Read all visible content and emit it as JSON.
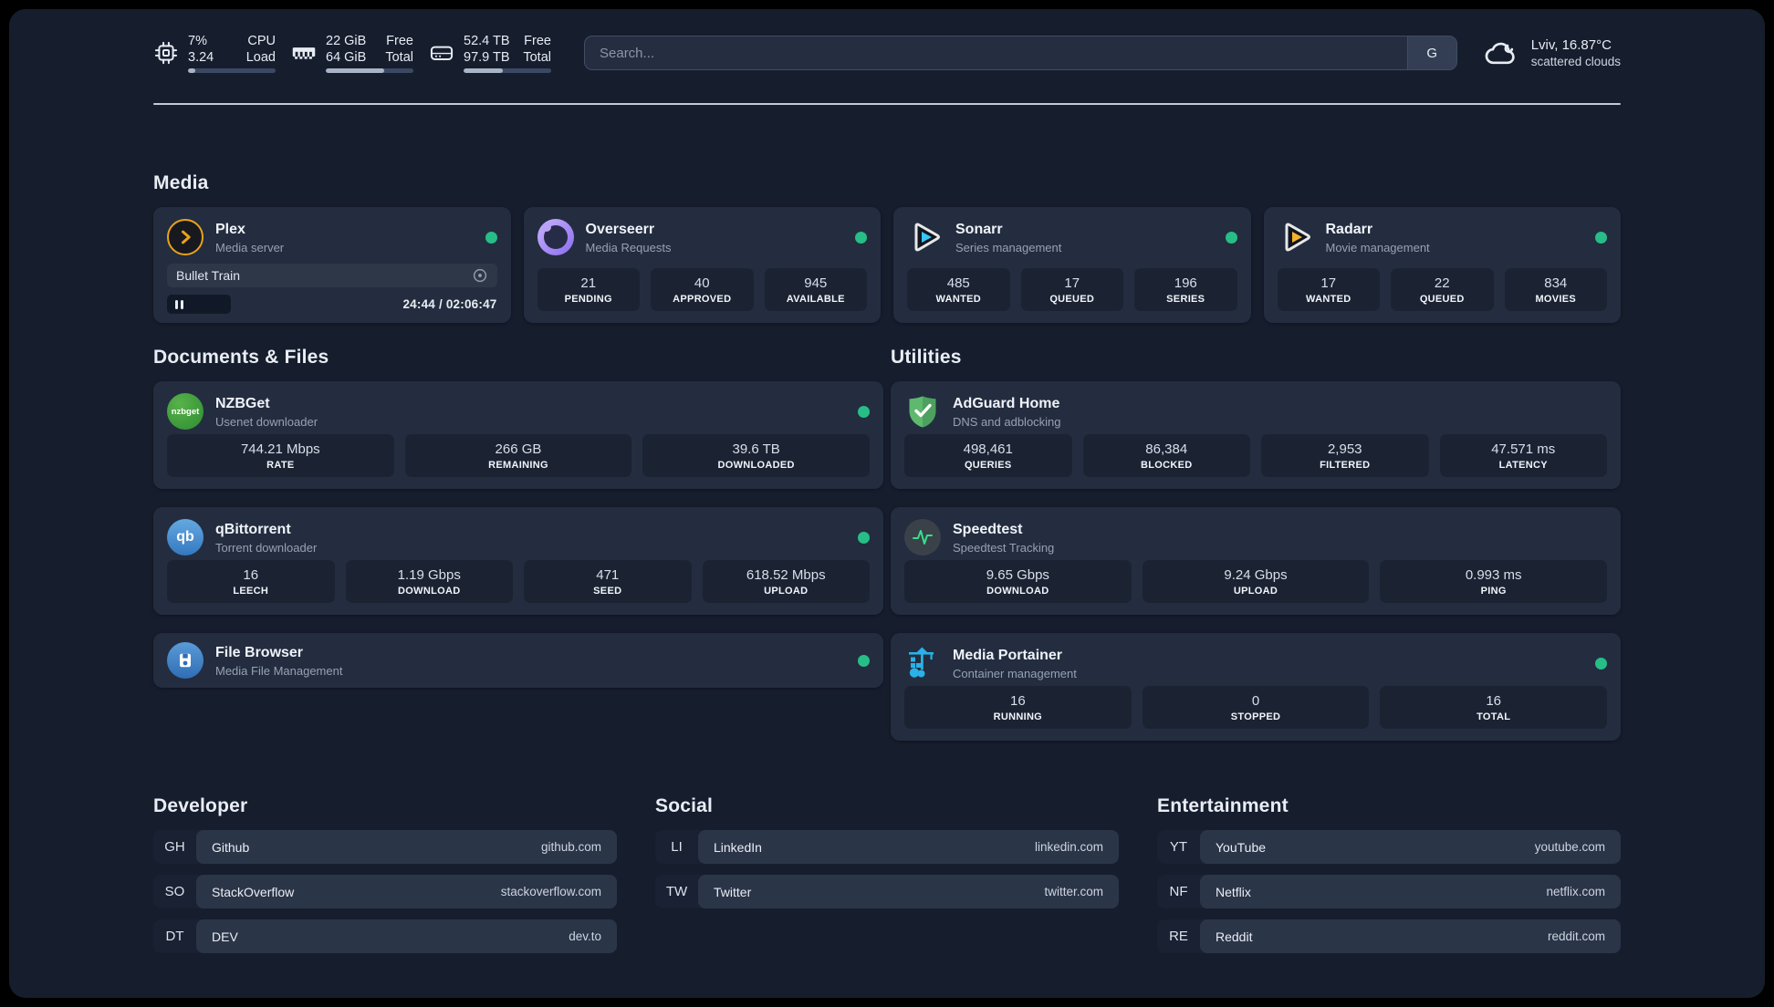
{
  "colors": {
    "page_bg": "#161d2d",
    "card_bg": "#232d3f",
    "stat_bg": "#1b2333",
    "status_online": "#27bd87",
    "plex_accent": "#e9a21b",
    "sonarr_accent": "#38c6f4",
    "radarr_accent": "#f5b12d",
    "portainer_accent": "#29b1e8",
    "adguard_accent": "#5eb86e",
    "speedtest_accent": "#35e08a"
  },
  "topbar": {
    "resources": [
      {
        "icon": "cpu-icon",
        "rows": [
          {
            "value": "7%",
            "label": "CPU"
          },
          {
            "value": "3.24",
            "label": "Load"
          }
        ],
        "progress_pct": 8
      },
      {
        "icon": "memory-icon",
        "rows": [
          {
            "value": "22 GiB",
            "label": "Free"
          },
          {
            "value": "64 GiB",
            "label": "Total"
          }
        ],
        "progress_pct": 67
      },
      {
        "icon": "disk-icon",
        "rows": [
          {
            "value": "52.4 TB",
            "label": "Free"
          },
          {
            "value": "97.9 TB",
            "label": "Total"
          }
        ],
        "progress_pct": 45
      }
    ],
    "search": {
      "placeholder": "Search...",
      "provider_label": "G"
    },
    "weather": {
      "icon": "cloud-icon",
      "location": "Lviv, 16.87°C",
      "condition": "scattered clouds"
    }
  },
  "sections": {
    "media": {
      "heading": "Media"
    },
    "documents": {
      "heading": "Documents & Files"
    },
    "utilities": {
      "heading": "Utilities"
    },
    "developer": {
      "heading": "Developer"
    },
    "social": {
      "heading": "Social"
    },
    "entertainment": {
      "heading": "Entertainment"
    }
  },
  "services": {
    "plex": {
      "icon": "plex-icon",
      "title": "Plex",
      "subtitle": "Media server",
      "status": "online",
      "now_playing": {
        "title": "Bullet Train",
        "time_display": "24:44 / 02:06:47",
        "progress_pct": 19.5
      }
    },
    "overseerr": {
      "icon": "overseerr-icon",
      "title": "Overseerr",
      "subtitle": "Media Requests",
      "status": "online",
      "stats": [
        {
          "value": "21",
          "label": "PENDING"
        },
        {
          "value": "40",
          "label": "APPROVED"
        },
        {
          "value": "945",
          "label": "AVAILABLE"
        }
      ]
    },
    "sonarr": {
      "icon": "sonarr-icon",
      "title": "Sonarr",
      "subtitle": "Series management",
      "status": "online",
      "stats": [
        {
          "value": "485",
          "label": "WANTED"
        },
        {
          "value": "17",
          "label": "QUEUED"
        },
        {
          "value": "196",
          "label": "SERIES"
        }
      ]
    },
    "radarr": {
      "icon": "radarr-icon",
      "title": "Radarr",
      "subtitle": "Movie management",
      "status": "online",
      "stats": [
        {
          "value": "17",
          "label": "WANTED"
        },
        {
          "value": "22",
          "label": "QUEUED"
        },
        {
          "value": "834",
          "label": "MOVIES"
        }
      ]
    },
    "nzbget": {
      "icon": "nzbget-icon",
      "icon_text": "nzbget",
      "title": "NZBGet",
      "subtitle": "Usenet downloader",
      "status": "online",
      "stats": [
        {
          "value": "744.21 Mbps",
          "label": "RATE"
        },
        {
          "value": "266 GB",
          "label": "REMAINING"
        },
        {
          "value": "39.6 TB",
          "label": "DOWNLOADED"
        }
      ]
    },
    "qbittorrent": {
      "icon": "qbittorrent-icon",
      "icon_text": "qb",
      "title": "qBittorrent",
      "subtitle": "Torrent downloader",
      "status": "online",
      "stats": [
        {
          "value": "16",
          "label": "LEECH"
        },
        {
          "value": "1.19 Gbps",
          "label": "DOWNLOAD"
        },
        {
          "value": "471",
          "label": "SEED"
        },
        {
          "value": "618.52 Mbps",
          "label": "UPLOAD"
        }
      ]
    },
    "filebrowser": {
      "icon": "filebrowser-icon",
      "title": "File Browser",
      "subtitle": "Media File Management",
      "status": "online"
    },
    "adguard": {
      "icon": "adguard-icon",
      "title": "AdGuard Home",
      "subtitle": "DNS and adblocking",
      "stats": [
        {
          "value": "498,461",
          "label": "QUERIES"
        },
        {
          "value": "86,384",
          "label": "BLOCKED"
        },
        {
          "value": "2,953",
          "label": "FILTERED"
        },
        {
          "value": "47.571 ms",
          "label": "LATENCY"
        }
      ]
    },
    "speedtest": {
      "icon": "speedtest-icon",
      "title": "Speedtest",
      "subtitle": "Speedtest Tracking",
      "stats": [
        {
          "value": "9.65 Gbps",
          "label": "DOWNLOAD"
        },
        {
          "value": "9.24 Gbps",
          "label": "UPLOAD"
        },
        {
          "value": "0.993 ms",
          "label": "PING"
        }
      ]
    },
    "portainer": {
      "icon": "portainer-icon",
      "title": "Media Portainer",
      "subtitle": "Container management",
      "status": "online",
      "stats": [
        {
          "value": "16",
          "label": "RUNNING"
        },
        {
          "value": "0",
          "label": "STOPPED"
        },
        {
          "value": "16",
          "label": "TOTAL"
        }
      ]
    }
  },
  "bookmarks": {
    "developer": [
      {
        "abbr": "GH",
        "name": "Github",
        "domain": "github.com"
      },
      {
        "abbr": "SO",
        "name": "StackOverflow",
        "domain": "stackoverflow.com"
      },
      {
        "abbr": "DT",
        "name": "DEV",
        "domain": "dev.to"
      }
    ],
    "social": [
      {
        "abbr": "LI",
        "name": "LinkedIn",
        "domain": "linkedin.com"
      },
      {
        "abbr": "TW",
        "name": "Twitter",
        "domain": "twitter.com"
      }
    ],
    "entertainment": [
      {
        "abbr": "YT",
        "name": "YouTube",
        "domain": "youtube.com"
      },
      {
        "abbr": "NF",
        "name": "Netflix",
        "domain": "netflix.com"
      },
      {
        "abbr": "RE",
        "name": "Reddit",
        "domain": "reddit.com"
      }
    ]
  }
}
